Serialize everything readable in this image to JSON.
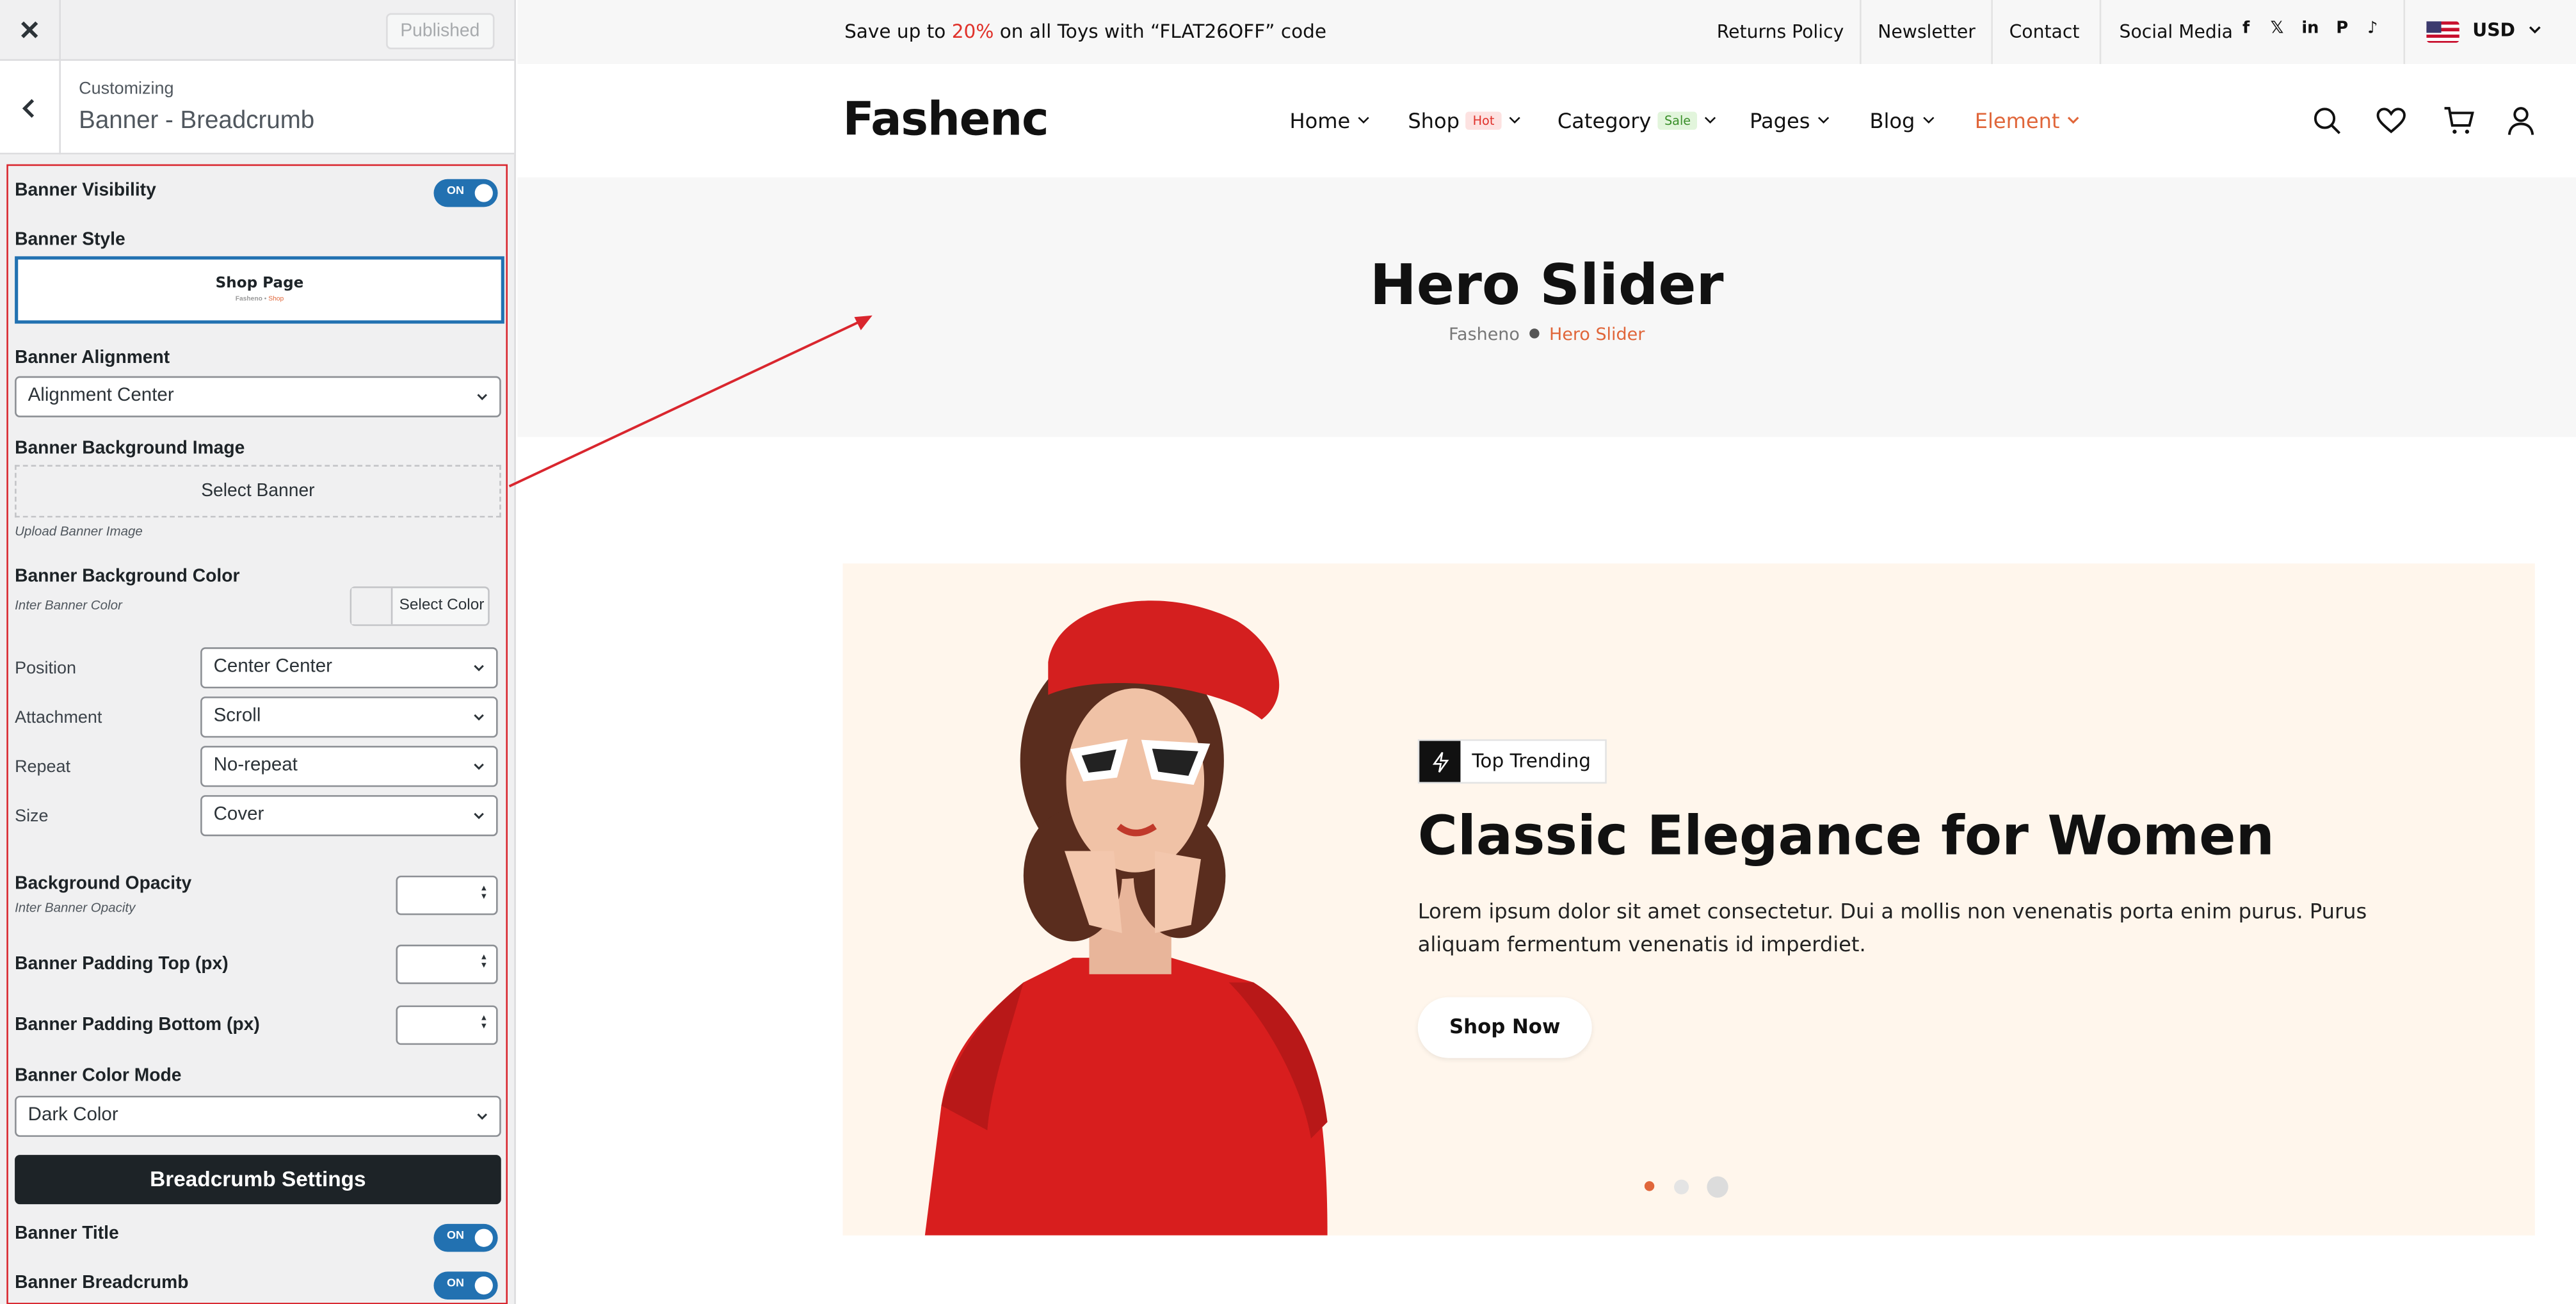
{
  "customizer": {
    "published_label": "Published",
    "section_sub": "Customizing",
    "section_title": "Banner - Breadcrumb",
    "banner_visibility": {
      "label": "Banner Visibility",
      "state": "ON"
    },
    "banner_style": {
      "label": "Banner Style",
      "preview_title": "Shop Page",
      "preview_crumb_home": "Fasheno",
      "preview_crumb_current": "Shop"
    },
    "banner_alignment": {
      "label": "Banner Alignment",
      "value": "Alignment Center"
    },
    "background_image": {
      "label": "Banner Background Image",
      "button": "Select Banner",
      "desc": "Upload Banner Image"
    },
    "background_color": {
      "label": "Banner Background Color",
      "desc": "Inter Banner Color",
      "button": "Select Color"
    },
    "position": {
      "label": "Position",
      "value": "Center Center"
    },
    "attachment": {
      "label": "Attachment",
      "value": "Scroll"
    },
    "repeat": {
      "label": "Repeat",
      "value": "No-repeat"
    },
    "size": {
      "label": "Size",
      "value": "Cover"
    },
    "background_opacity": {
      "label": "Background Opacity",
      "desc": "Inter Banner Opacity",
      "value": ""
    },
    "padding_top": {
      "label": "Banner Padding Top (px)",
      "value": ""
    },
    "padding_bottom": {
      "label": "Banner Padding Bottom (px)",
      "value": ""
    },
    "color_mode": {
      "label": "Banner Color Mode",
      "value": "Dark Color"
    },
    "breadcrumb_settings": "Breadcrumb Settings",
    "banner_title": {
      "label": "Banner Title",
      "state": "ON"
    },
    "banner_breadcrumb": {
      "label": "Banner Breadcrumb",
      "state": "ON"
    }
  },
  "site": {
    "promo": {
      "prefix": "Save up to",
      "highlight": "20%",
      "suffix": "on all Toys with “FLAT26OFF” code"
    },
    "top_links": [
      "Returns Policy",
      "Newsletter",
      "Contact"
    ],
    "social_label": "Social Media",
    "social_icons": [
      "f",
      "𝕏",
      "in",
      "P",
      "♪"
    ],
    "currency": "USD",
    "logo": "Fashenc",
    "nav": [
      {
        "label": "Home",
        "badge": ""
      },
      {
        "label": "Shop",
        "badge": "Hot"
      },
      {
        "label": "Category",
        "badge": "Sale"
      },
      {
        "label": "Pages",
        "badge": ""
      },
      {
        "label": "Blog",
        "badge": ""
      },
      {
        "label": "Element",
        "badge": ""
      }
    ],
    "banner": {
      "title": "Hero Slider",
      "crumb_home": "Fasheno",
      "crumb_current": "Hero Slider"
    },
    "hero": {
      "tag": "Top Trending",
      "heading": "Classic Elegance for Women",
      "text": "Lorem ipsum dolor sit amet consectetur. Dui a mollis non venenatis porta enim purus. Purus aliquam fermentum venenatis id imperdiet.",
      "button": "Shop Now",
      "slide_count": 3,
      "active_slide": 1
    }
  },
  "colors": {
    "accent": "#e0663a",
    "highlight_box": "#d9262e",
    "toggle_on": "#2271b1",
    "hero_bg": "#fff6ec"
  }
}
